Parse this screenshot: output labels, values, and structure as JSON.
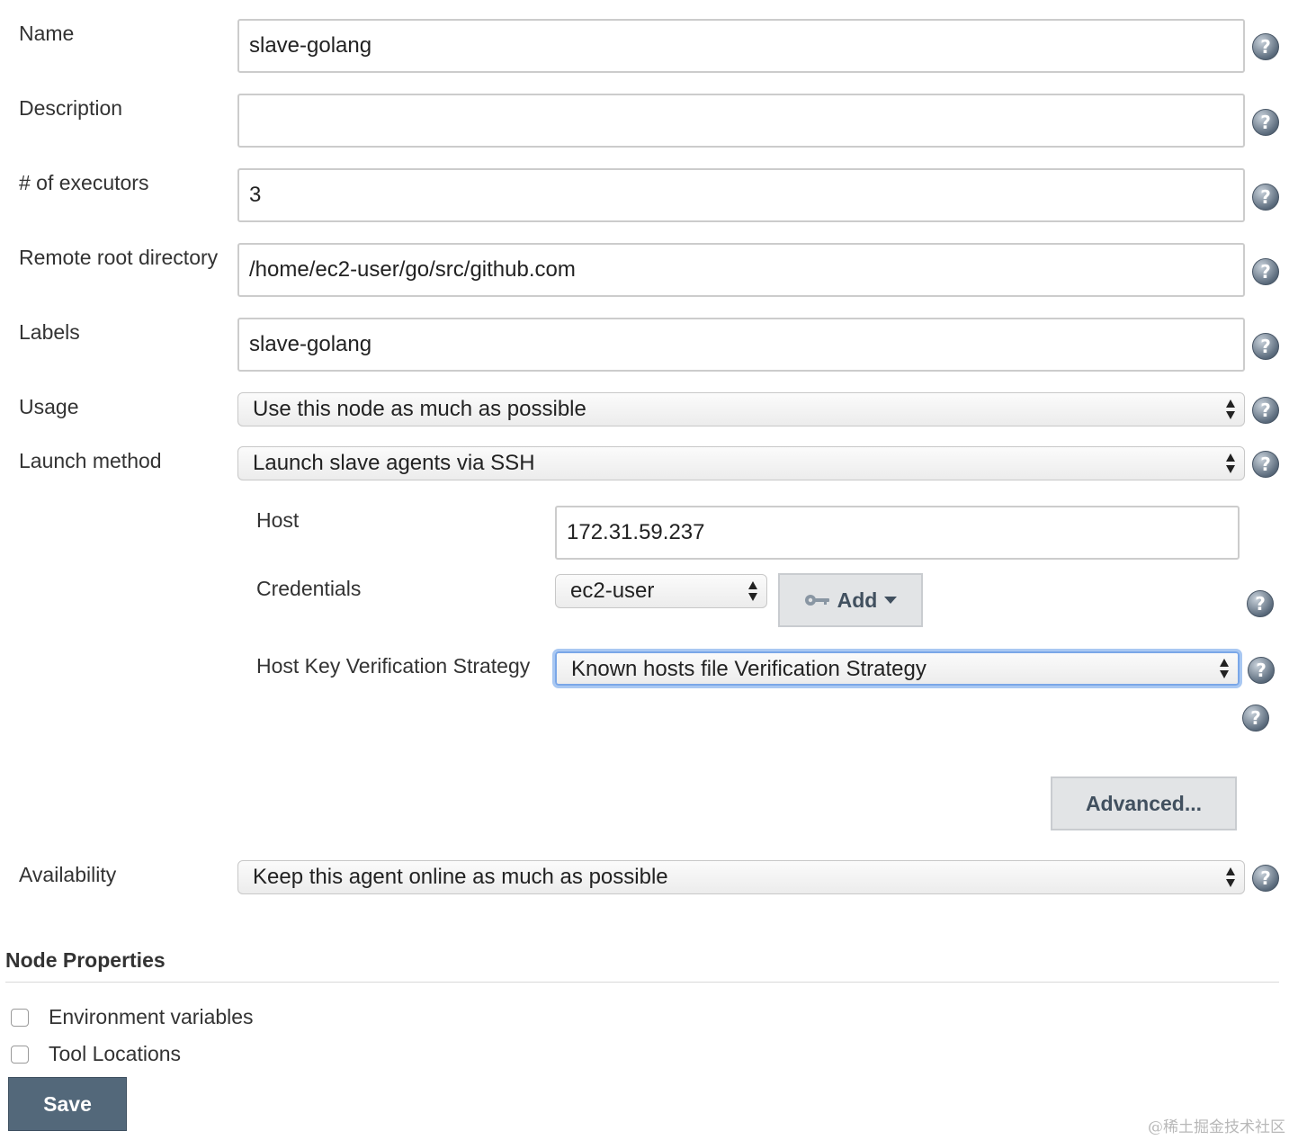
{
  "form": {
    "name": {
      "label": "Name",
      "value": "slave-golang"
    },
    "description": {
      "label": "Description",
      "value": ""
    },
    "executors": {
      "label": "# of executors",
      "value": "3"
    },
    "remote_root": {
      "label": "Remote root directory",
      "value": "/home/ec2-user/go/src/github.com"
    },
    "labels": {
      "label": "Labels",
      "value": "slave-golang"
    },
    "usage": {
      "label": "Usage",
      "selected": "Use this node as much as possible"
    },
    "launch_method": {
      "label": "Launch method",
      "selected": "Launch slave agents via SSH"
    }
  },
  "ssh": {
    "host": {
      "label": "Host",
      "value": "172.31.59.237"
    },
    "credentials": {
      "label": "Credentials",
      "selected": "ec2-user",
      "add_label": "Add"
    },
    "host_key": {
      "label": "Host Key Verification Strategy",
      "selected": "Known hosts file Verification Strategy"
    },
    "advanced_label": "Advanced..."
  },
  "availability": {
    "label": "Availability",
    "selected": "Keep this agent online as much as possible"
  },
  "node_properties": {
    "title": "Node Properties",
    "items": [
      {
        "label": "Environment variables",
        "checked": false
      },
      {
        "label": "Tool Locations",
        "checked": false
      }
    ]
  },
  "save_label": "Save",
  "help_glyph": "?",
  "watermark": "@稀土掘金技术社区",
  "icons": {
    "help": "help-icon",
    "key": "key-icon",
    "caret": "caret-down-icon"
  },
  "colors": {
    "save_bg": "#53687a",
    "focus_ring": "#7aa7e8",
    "help_bg": "#5c6c7d"
  }
}
